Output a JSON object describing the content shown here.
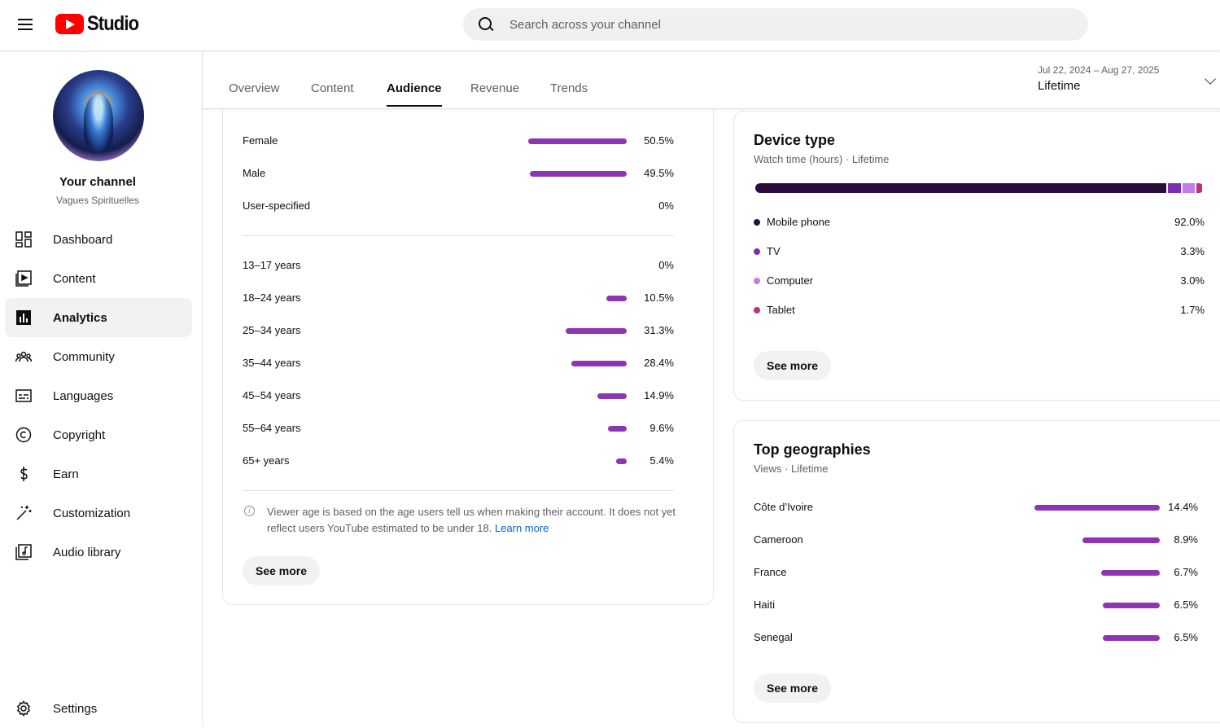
{
  "header": {
    "logo_text": "Studio",
    "search_placeholder": "Search across your channel"
  },
  "sidebar": {
    "channel_title": "Your channel",
    "channel_name": "Vagues Spirituelles",
    "items": [
      {
        "label": "Dashboard",
        "icon": "dashboard-icon"
      },
      {
        "label": "Content",
        "icon": "content-icon"
      },
      {
        "label": "Analytics",
        "icon": "analytics-icon",
        "active": true
      },
      {
        "label": "Community",
        "icon": "community-icon"
      },
      {
        "label": "Languages",
        "icon": "languages-icon"
      },
      {
        "label": "Copyright",
        "icon": "copyright-icon"
      },
      {
        "label": "Earn",
        "icon": "earn-icon"
      },
      {
        "label": "Customization",
        "icon": "customization-icon"
      },
      {
        "label": "Audio library",
        "icon": "audio-library-icon"
      }
    ],
    "settings_label": "Settings"
  },
  "tabs": {
    "items": [
      "Overview",
      "Content",
      "Audience",
      "Revenue",
      "Trends"
    ],
    "active": "Audience",
    "date_range": "Jul 22, 2024 – Aug 27, 2025",
    "period": "Lifetime"
  },
  "demographics": {
    "gender": [
      {
        "label": "Female",
        "value": "50.5%",
        "fraction": 0.505
      },
      {
        "label": "Male",
        "value": "49.5%",
        "fraction": 0.495
      },
      {
        "label": "User-specified",
        "value": "0%",
        "fraction": 0
      }
    ],
    "age": [
      {
        "label": "13–17 years",
        "value": "0%",
        "fraction": 0
      },
      {
        "label": "18–24 years",
        "value": "10.5%",
        "fraction": 0.105
      },
      {
        "label": "25–34 years",
        "value": "31.3%",
        "fraction": 0.313
      },
      {
        "label": "35–44 years",
        "value": "28.4%",
        "fraction": 0.284
      },
      {
        "label": "45–54 years",
        "value": "14.9%",
        "fraction": 0.149
      },
      {
        "label": "55–64 years",
        "value": "9.6%",
        "fraction": 0.096
      },
      {
        "label": "65+ years",
        "value": "5.4%",
        "fraction": 0.054
      }
    ],
    "note": "Viewer age is based on the age users tell us when making their account. It does not yet reflect users YouTube estimated to be under 18.",
    "learn_more": "Learn more",
    "see_more": "See more"
  },
  "device": {
    "title": "Device type",
    "subtitle": "Watch time (hours) · Lifetime",
    "items": [
      {
        "label": "Mobile phone",
        "value": "92.0%",
        "fraction": 0.92,
        "color": "#2b0c3e"
      },
      {
        "label": "TV",
        "value": "3.3%",
        "fraction": 0.033,
        "color": "#7b2fb0"
      },
      {
        "label": "Computer",
        "value": "3.0%",
        "fraction": 0.03,
        "color": "#c07ee6"
      },
      {
        "label": "Tablet",
        "value": "1.7%",
        "fraction": 0.017,
        "color": "#c2307a"
      }
    ],
    "see_more": "See more"
  },
  "geographies": {
    "title": "Top geographies",
    "subtitle": "Views · Lifetime",
    "items": [
      {
        "label": "Côte d’Ivoire",
        "value": "14.4%",
        "fraction": 0.144
      },
      {
        "label": "Cameroon",
        "value": "8.9%",
        "fraction": 0.089
      },
      {
        "label": "France",
        "value": "6.7%",
        "fraction": 0.067
      },
      {
        "label": "Haiti",
        "value": "6.5%",
        "fraction": 0.065
      },
      {
        "label": "Senegal",
        "value": "6.5%",
        "fraction": 0.065
      }
    ],
    "see_more": "See more"
  },
  "colors": {
    "bar": "#8e35b4",
    "youtube_red": "#ff0000",
    "link": "#065fd4"
  }
}
